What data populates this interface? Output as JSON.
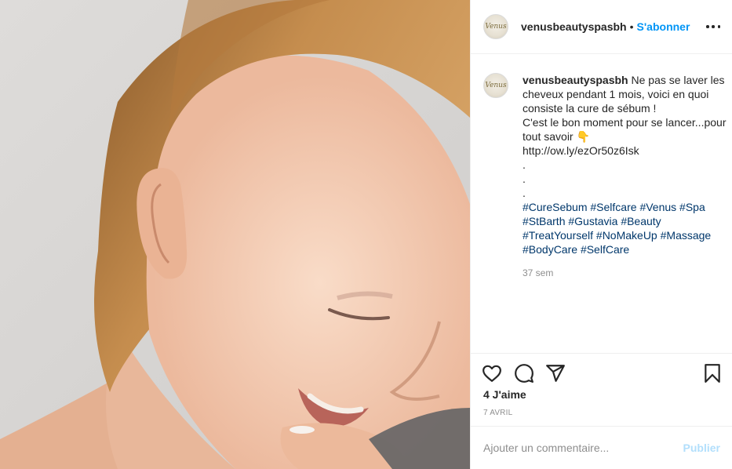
{
  "post": {
    "image_alt": "",
    "account": {
      "username": "venusbeautyspasbh",
      "avatar_text": "Venus",
      "separator": "•",
      "follow_label": "S'abonner"
    },
    "caption": {
      "username": "venusbeautyspasbh",
      "lines": [
        "Ne pas se laver les cheveux pendant 1 mois, voici en quoi consiste la cure de sébum !",
        "C'est le bon moment pour se lancer...pour tout savoir 👇",
        "http://ow.ly/ezOr50z6Isk",
        ".",
        ".",
        "."
      ],
      "hashtags": [
        "#CureSebum",
        "#Selfcare",
        "#Venus",
        "#Spa",
        "#StBarth",
        "#Gustavia",
        "#Beauty",
        "#TreatYourself",
        "#NoMakeUp",
        "#Massage",
        "#BodyCare",
        "#SelfCare"
      ],
      "age": "37 sem"
    },
    "likes": "4 J'aime",
    "date": "7 avril",
    "comment_box": {
      "placeholder": "Ajouter un commentaire...",
      "publish_label": "Publier"
    },
    "icons": {
      "like": "heart-icon",
      "comment": "comment-icon",
      "share": "paper-plane-icon",
      "save": "bookmark-icon",
      "more": "more-options-icon"
    },
    "colors": {
      "follow": "#0095f6",
      "hashtag": "#00376b",
      "publish_disabled": "#b2dffc",
      "muted": "#8e8e8e"
    }
  }
}
